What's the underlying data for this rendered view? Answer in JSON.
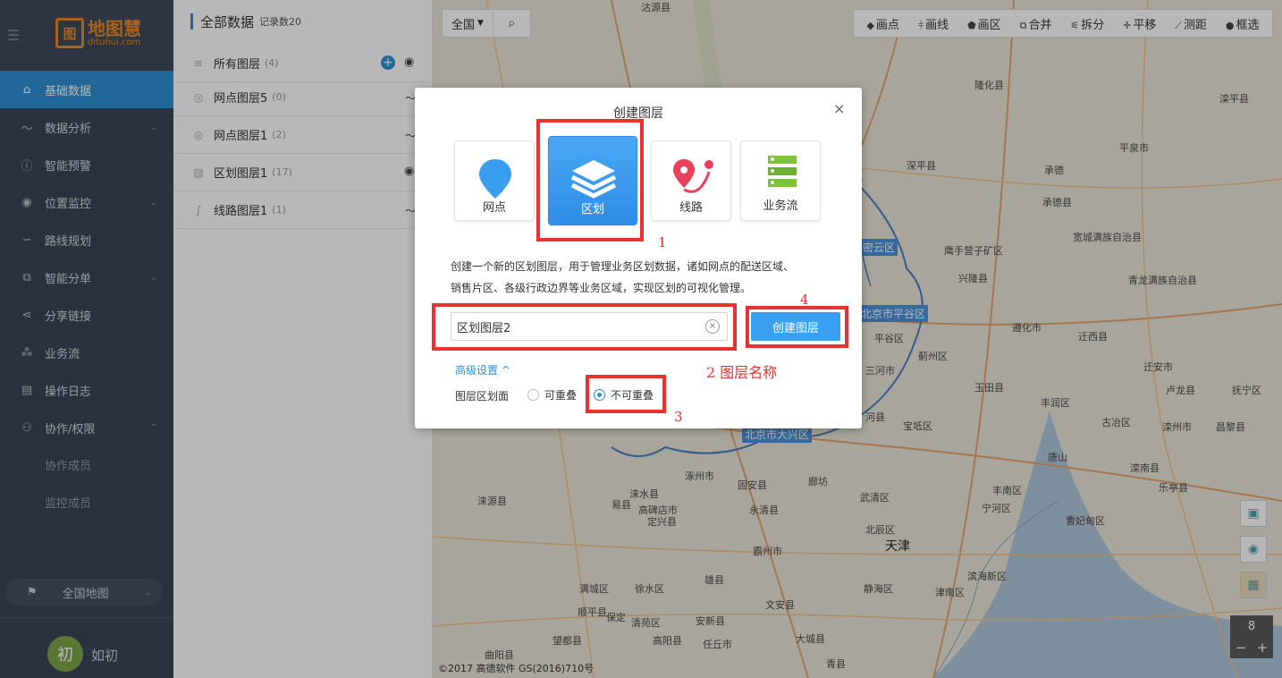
{
  "sidebar": {
    "logo_mark": "图",
    "logo_title": "地图慧",
    "logo_sub": "dituhui.com",
    "menu_icon": "hamburger-icon",
    "items": [
      {
        "label": "基础数据",
        "icon": "home-icon",
        "active": true
      },
      {
        "label": "数据分析",
        "icon": "chart-icon",
        "chevron": "down"
      },
      {
        "label": "智能预警",
        "icon": "alert-icon"
      },
      {
        "label": "位置监控",
        "icon": "location-icon",
        "chevron": "down"
      },
      {
        "label": "路线规划",
        "icon": "route-icon"
      },
      {
        "label": "智能分单",
        "icon": "dispatch-icon",
        "chevron": "down"
      },
      {
        "label": "分享链接",
        "icon": "share-icon"
      },
      {
        "label": "业务流",
        "icon": "flow-icon"
      },
      {
        "label": "操作日志",
        "icon": "log-icon"
      },
      {
        "label": "协作/权限",
        "icon": "users-icon",
        "chevron": "up"
      }
    ],
    "sub_items": [
      "协作成员",
      "监控成员"
    ],
    "map_select": "全国地图",
    "avatar_initial": "初",
    "username": "如初"
  },
  "panel": {
    "title": "全部数据",
    "record_count": "记录数20",
    "layers": [
      {
        "name": "所有图层",
        "count": "(4)",
        "icon": "layers-icon"
      },
      {
        "name": "网点图层5",
        "count": "(0)",
        "icon": "pin-icon"
      },
      {
        "name": "网点图层1",
        "count": "(2)",
        "icon": "pin-icon"
      },
      {
        "name": "区划图层1",
        "count": "(17)",
        "icon": "region-icon"
      },
      {
        "name": "线路图层1",
        "count": "(1)",
        "icon": "line-icon"
      }
    ]
  },
  "map": {
    "region_select": "全国",
    "tools": [
      "画点",
      "画线",
      "画区",
      "合并",
      "拆分",
      "平移",
      "测距",
      "框选"
    ],
    "zoom_level": "8",
    "zoom_in": "+",
    "zoom_out": "−",
    "copyright": "©2017 高德软件 GS(2016)710号",
    "places": [
      "沽源县",
      "隆化县",
      "滦平县",
      "平泉市",
      "承德",
      "承德县",
      "深平县",
      "宽城满族自治县",
      "密云区",
      "鹰手营子矿区",
      "兴隆县",
      "青龙满族自治县",
      "北京市平谷区",
      "平谷区",
      "遵化市",
      "迁西县",
      "蓟州区",
      "迁安市",
      "三河市",
      "玉田县",
      "丰润区",
      "卢龙县",
      "抚宁区",
      "河县",
      "宝坻区",
      "古冶区",
      "北京市大兴区",
      "唐山",
      "滦州市",
      "昌黎县",
      "涿州市",
      "固安县",
      "廊坊",
      "武清区",
      "宁河区",
      "涞源县",
      "易县",
      "涞水县",
      "高碑店市",
      "永清县",
      "丰南区",
      "滦南县",
      "乐亭县",
      "定兴县",
      "北辰区",
      "曹妃甸区",
      "霸州市",
      "天津",
      "滨海新区",
      "满城区",
      "徐水区",
      "雄县",
      "静海区",
      "津南区",
      "保定",
      "清苑区",
      "安新县",
      "文安县",
      "顺平县",
      "望都县",
      "高阳县",
      "任丘市",
      "大城县",
      "曲阳县",
      "青县"
    ]
  },
  "dialog": {
    "title": "创建图层",
    "close": "×",
    "types": [
      {
        "label": "网点",
        "icon": "pin-icon"
      },
      {
        "label": "区划",
        "icon": "layers-icon",
        "selected": true
      },
      {
        "label": "线路",
        "icon": "route-icon"
      },
      {
        "label": "业务流",
        "icon": "flow-icon"
      }
    ],
    "description_line1": "创建一个新的区划图层，用于管理业务区划数据，诸如网点的配送区域、",
    "description_line2": "销售片区、各级行政边界等业务区域，实现区划的可视化管理。",
    "name_value": "区划图层2",
    "create_button": "创建图层",
    "advanced": "高级设置 ^",
    "overlap_label": "图层区划面",
    "overlap_options": [
      "可重叠",
      "不可重叠"
    ],
    "overlap_selected": "不可重叠"
  },
  "annotations": {
    "n1": "1",
    "n2": "2  图层名称",
    "n3": "3",
    "n4": "4",
    "color": "#e8322e"
  },
  "colors": {
    "accent": "#2e8fd1",
    "sidebar": "#3a4656",
    "brand": "#e8892a"
  }
}
